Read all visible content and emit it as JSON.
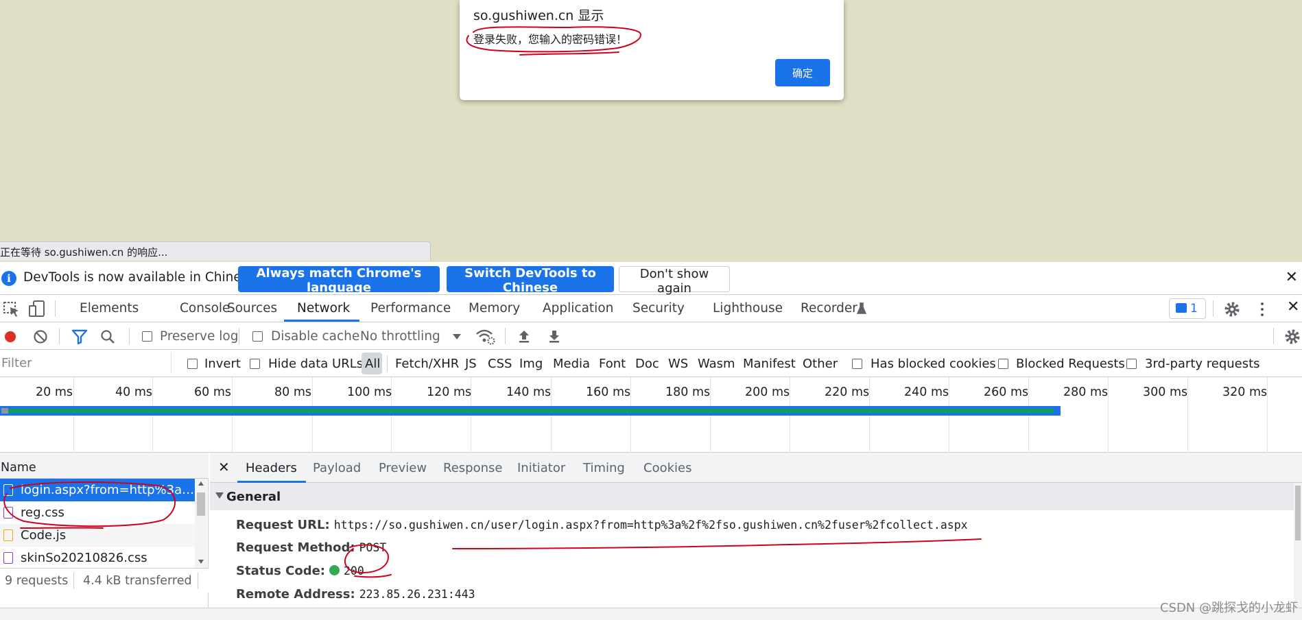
{
  "page": {
    "alert": {
      "title": "so.gushiwen.cn 显示",
      "message": "登录失败，您输入的密码错误！",
      "ok_label": "确定"
    },
    "status_text": "正在等待 so.gushiwen.cn 的响应..."
  },
  "devtools": {
    "infobar": {
      "text": "DevTools is now available in Chinese!",
      "btn_match": "Always match Chrome's language",
      "btn_switch": "Switch DevTools to Chinese",
      "btn_dismiss": "Don't show again"
    },
    "tabs": [
      "Elements",
      "Console",
      "Sources",
      "Network",
      "Performance",
      "Memory",
      "Application",
      "Security",
      "Lighthouse",
      "Recorder"
    ],
    "active_tab": "Network",
    "issues_count": "1",
    "toolbar": {
      "preserve_log": "Preserve log",
      "disable_cache": "Disable cache",
      "throttling": "No throttling"
    },
    "filter": {
      "placeholder": "Filter",
      "invert": "Invert",
      "hide_data_urls": "Hide data URLs",
      "types": [
        "All",
        "Fetch/XHR",
        "JS",
        "CSS",
        "Img",
        "Media",
        "Font",
        "Doc",
        "WS",
        "Wasm",
        "Manifest",
        "Other"
      ],
      "has_blocked_cookies": "Has blocked cookies",
      "blocked_requests": "Blocked Requests",
      "third_party": "3rd-party requests"
    },
    "timeline_ticks": [
      "20 ms",
      "40 ms",
      "60 ms",
      "80 ms",
      "100 ms",
      "120 ms",
      "140 ms",
      "160 ms",
      "180 ms",
      "200 ms",
      "220 ms",
      "240 ms",
      "260 ms",
      "280 ms",
      "300 ms",
      "320 ms"
    ],
    "requests": {
      "header": "Name",
      "items": [
        {
          "name": "login.aspx?from=http%3a%2f...",
          "kind": "doc"
        },
        {
          "name": "reg.css",
          "kind": "css"
        },
        {
          "name": "Code.js",
          "kind": "js"
        },
        {
          "name": "skinSo20210826.css",
          "kind": "css"
        }
      ],
      "summary_requests": "9 requests",
      "summary_transferred": "4.4 kB transferred"
    },
    "detail": {
      "tabs": [
        "Headers",
        "Payload",
        "Preview",
        "Response",
        "Initiator",
        "Timing",
        "Cookies"
      ],
      "active_tab": "Headers",
      "general_title": "General",
      "request_url_label": "Request URL:",
      "request_url": "https://so.gushiwen.cn/user/login.aspx?from=http%3a%2f%2fso.gushiwen.cn%2fuser%2fcollect.aspx",
      "request_method_label": "Request Method:",
      "request_method": "POST",
      "status_code_label": "Status Code:",
      "status_code": "200",
      "remote_address_label": "Remote Address:",
      "remote_address": "223.85.26.231:443"
    }
  },
  "watermark": "CSDN @跳探戈的小龙虾",
  "colors": {
    "page_bg": "#e0dfc5",
    "accent": "#1a73e8",
    "status_green": "#34a853",
    "annotation_red": "#d0021b"
  }
}
